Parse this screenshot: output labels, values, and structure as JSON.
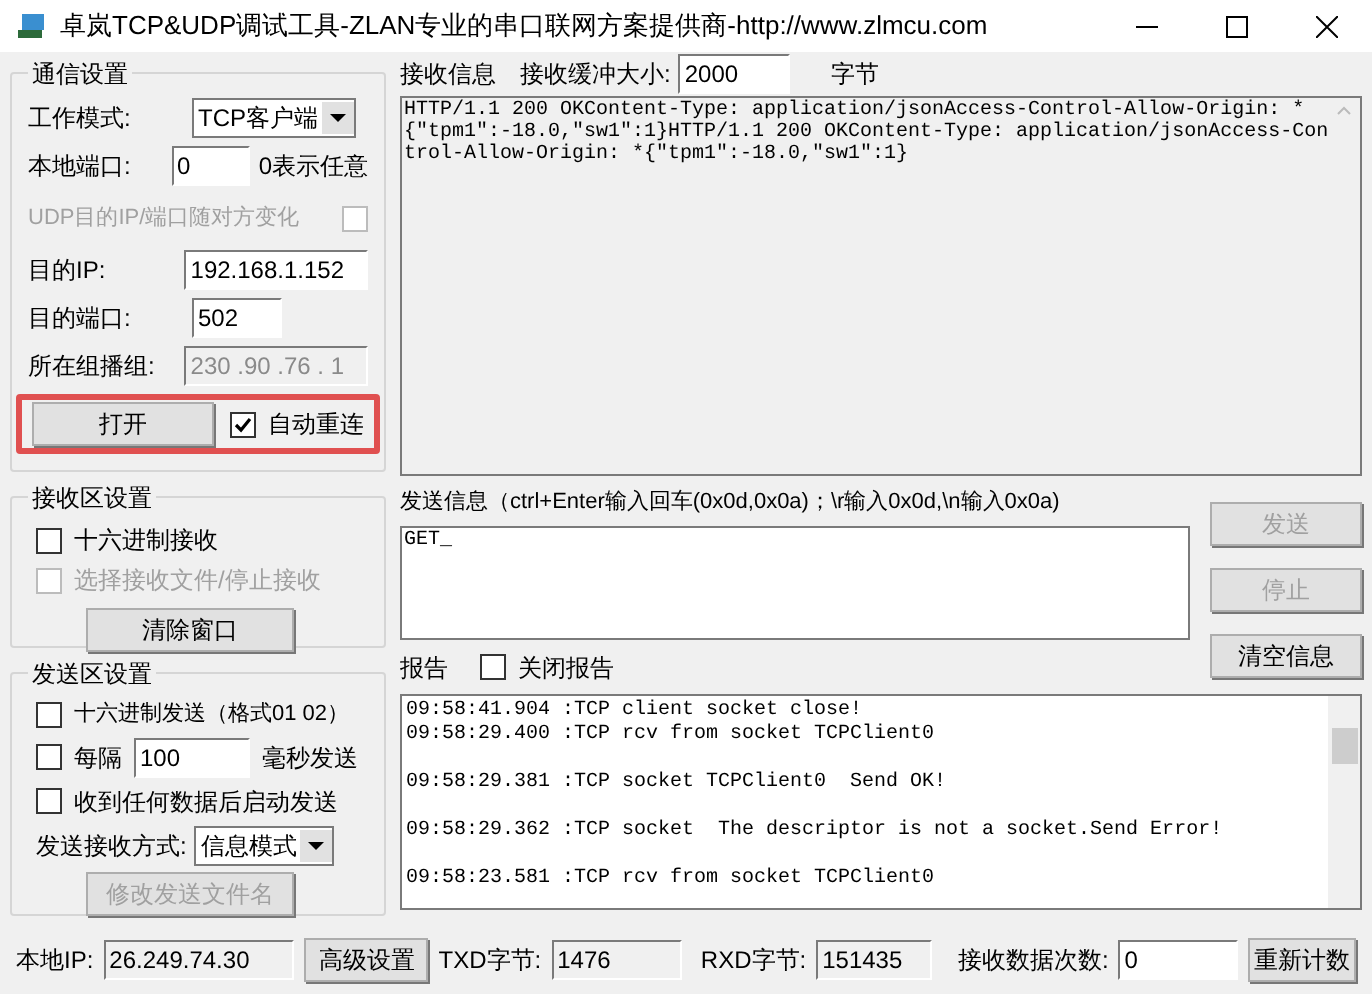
{
  "window": {
    "title": "卓岚TCP&UDP调试工具-ZLAN专业的串口联网方案提供商-http://www.zlmcu.com"
  },
  "comm_settings": {
    "title": "通信设置",
    "work_mode": {
      "label": "工作模式:",
      "value": "TCP客户端"
    },
    "local_port": {
      "label": "本地端口:",
      "value": "0",
      "hint": "0表示任意"
    },
    "udp_follow": {
      "label": "UDP目的IP/端口随对方变化",
      "checked": false,
      "disabled": true
    },
    "dest_ip": {
      "label": "目的IP:",
      "value": "192.168.1.152"
    },
    "dest_port": {
      "label": "目的端口:",
      "value": "502"
    },
    "multicast": {
      "label": "所在组播组:",
      "value": "230 .90 .76 . 1",
      "disabled": true
    },
    "open_button": "打开",
    "auto_reconnect": {
      "label": "自动重连",
      "checked": true
    }
  },
  "receive_settings": {
    "title": "接收区设置",
    "options": [
      {
        "label": "十六进制接收",
        "checked": false,
        "disabled": false
      },
      {
        "label": "选择接收文件/停止接收",
        "checked": false,
        "disabled": true
      }
    ],
    "clear_button": "清除窗口"
  },
  "send_settings": {
    "title": "发送区设置",
    "hex_send": {
      "label": "十六进制发送（格式01 02）",
      "checked": false
    },
    "interval": {
      "label": "每隔",
      "value": "100",
      "unit": "毫秒发送",
      "checked": false
    },
    "start_on_receive": {
      "label": "收到任何数据后启动发送",
      "checked": false
    },
    "send_mode": {
      "label": "发送接收方式:",
      "value": "信息模式"
    },
    "rename_button": {
      "label": "修改发送文件名",
      "disabled": true
    }
  },
  "receive": {
    "title": "接收信息",
    "buffer_label": "接收缓冲大小:",
    "buffer_value": "2000",
    "buffer_unit": "字节",
    "content": "HTTP/1.1 200 OKContent-Type: application/jsonAccess-Control-Allow-Origin: *{\"tpm1\":-18.0,\"sw1\":1}HTTP/1.1 200 OKContent-Type: application/jsonAccess-Control-Allow-Origin: *{\"tpm1\":-18.0,\"sw1\":1}"
  },
  "send": {
    "title": "发送信息（ctrl+Enter输入回车(0x0d,0x0a)；\\r输入0x0d,\\n输入0x0a)",
    "content": "GET_",
    "buttons": [
      {
        "label": "发送",
        "disabled": true
      },
      {
        "label": "停止",
        "disabled": true
      },
      {
        "label": "清空信息",
        "disabled": false
      }
    ]
  },
  "report": {
    "title": "报告",
    "close_report": {
      "label": "关闭报告",
      "checked": false
    },
    "lines": [
      {
        "text": "09:58:41.904 :TCP client socket close!",
        "gap_before": false
      },
      {
        "text": "09:58:29.400 :TCP rcv from socket TCPClient0",
        "gap_before": false
      },
      {
        "text": "09:58:29.381 :TCP socket TCPClient0  Send OK!",
        "gap_before": true
      },
      {
        "text": "09:58:29.362 :TCP socket  The descriptor is not a socket.Send Error!",
        "gap_before": true
      },
      {
        "text": "09:58:23.581 :TCP rcv from socket TCPClient0",
        "gap_before": true
      }
    ]
  },
  "status_bar": {
    "local_ip": {
      "label": "本地IP:",
      "value": "26.249.74.30"
    },
    "advanced_button": "高级设置",
    "txd": {
      "label": "TXD字节:",
      "value": "1476"
    },
    "rxd": {
      "label": "RXD字节:",
      "value": "151435"
    },
    "count": {
      "label": "接收数据次数:",
      "value": "0"
    },
    "reset_button": "重新计数"
  }
}
